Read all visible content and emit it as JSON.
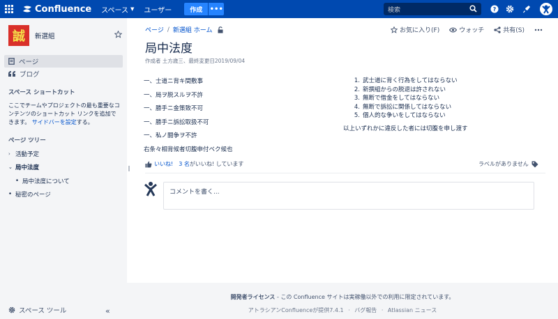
{
  "topbar": {
    "product_name": "Confluence",
    "nav_spaces": "スペース",
    "nav_people": "ユーザー",
    "create_label": "作成",
    "more_label": "•••",
    "search_placeholder": "検索"
  },
  "sidebar": {
    "space_name": "新選組",
    "space_logo_char": "誠",
    "nav": [
      {
        "label": "ページ"
      },
      {
        "label": "ブログ"
      }
    ],
    "shortcuts_title": "スペース ショートカット",
    "shortcuts_text": "ここでチームやプロジェクトの最も重要なコンテンツのショートカット リンクを追加できます。",
    "shortcuts_link": "サイドバーを設定",
    "shortcuts_suffix": "する。",
    "tree_title": "ページ ツリー",
    "tree": [
      {
        "label": "活動予定"
      },
      {
        "label": "局中法度"
      },
      {
        "label": "局中法度について"
      },
      {
        "label": "秘密のページ"
      }
    ],
    "space_tools": "スペース ツール"
  },
  "page": {
    "breadcrumb": [
      "ページ",
      "新選組 ホーム"
    ],
    "actions": {
      "favorite": "お気に入り(F)",
      "watch": "ウォッチ",
      "share": "共有(S)"
    },
    "title": "局中法度",
    "byline": "作成者 土方歳三、最終変更日2019/09/04",
    "left_lines": [
      "一、士道ニ背キ間敷事",
      "一、局ヲ脱スルヲ不許",
      "一、勝手ニ金策致不可",
      "一、勝手ニ訴訟取扱不可",
      "一、私ノ闘争ヲ不許",
      "右条々相背候者切腹申付ベク候也"
    ],
    "right_list": [
      {
        "num": "1.",
        "text": "武士道に背く行為をしてはならない"
      },
      {
        "num": "2.",
        "text": "新撰組からの脱退は許されない"
      },
      {
        "num": "3.",
        "text": "無断で借金をしてはならない"
      },
      {
        "num": "4.",
        "text": "無断で訴訟に関係してはならない"
      },
      {
        "num": "5.",
        "text": "個人的な争いをしてはならない"
      }
    ],
    "right_note": "以上いずれかに違反した者には切腹を申し渡す",
    "like_label": "いいね!",
    "like_count": "3 名",
    "like_suffix": "がいいね! しています",
    "labels_text": "ラベルがありません",
    "comment_placeholder": "コメントを書く..."
  },
  "footer": {
    "license_bold": "開発者ライセンス",
    "license_text": " - この Confluence サイトは実稼働以外での利用に限定されています。",
    "powered": "アトラシアンConfluenceが提供7.4.1",
    "bug_report": "バグ報告",
    "news": "Atlassian ニュース"
  },
  "colors": {
    "topbar": "#0049b0",
    "create": "#2684ff",
    "link": "#0052cc",
    "space_logo_bg": "#d9302a",
    "space_logo_fg": "#f5e04a"
  }
}
